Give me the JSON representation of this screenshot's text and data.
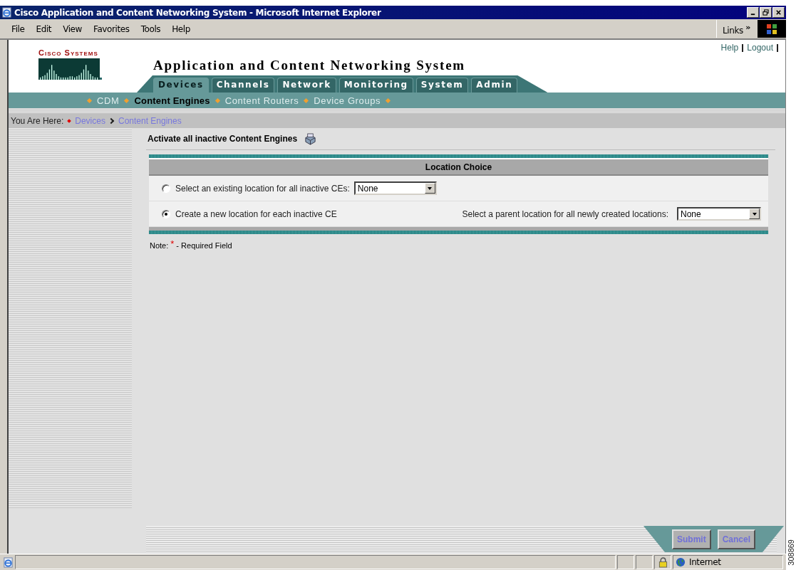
{
  "window": {
    "title": "Cisco Application and Content Networking System - Microsoft Internet Explorer"
  },
  "menu": [
    "File",
    "Edit",
    "View",
    "Favorites",
    "Tools",
    "Help"
  ],
  "links_bar": {
    "label": "Links",
    "chevron": "»"
  },
  "header": {
    "logo_text": "Cisco Systems",
    "app_title": "Application and Content Networking System",
    "top_links": [
      "Help",
      "Logout"
    ]
  },
  "tabs": [
    {
      "label": "Devices",
      "selected": true
    },
    {
      "label": "Channels",
      "selected": false
    },
    {
      "label": "Network",
      "selected": false
    },
    {
      "label": "Monitoring",
      "selected": false
    },
    {
      "label": "System",
      "selected": false
    },
    {
      "label": "Admin",
      "selected": false
    }
  ],
  "subnav": [
    {
      "label": "CDM",
      "selected": false
    },
    {
      "label": "Content Engines",
      "selected": true
    },
    {
      "label": "Content Routers",
      "selected": false
    },
    {
      "label": "Device Groups",
      "selected": false
    }
  ],
  "breadcrumb": {
    "label": "You Are Here:",
    "items": [
      "Devices",
      "Content Engines"
    ]
  },
  "page_heading": "Activate all inactive Content Engines",
  "form": {
    "heading": "Location Choice",
    "options": [
      {
        "label": "Select an existing location for all inactive CEs:",
        "selected": false,
        "select": {
          "value": "None"
        }
      },
      {
        "label": "Create a new location for each inactive CE",
        "selected": true,
        "extra_label": "Select a parent location for all newly created locations:",
        "select": {
          "value": "None"
        }
      }
    ]
  },
  "note": {
    "label": "Note:",
    "mark": "*",
    "text": "- Required Field"
  },
  "buttons": [
    "Submit",
    "Cancel"
  ],
  "status_bar": {
    "zone": "Internet"
  },
  "figure_id": "308869"
}
